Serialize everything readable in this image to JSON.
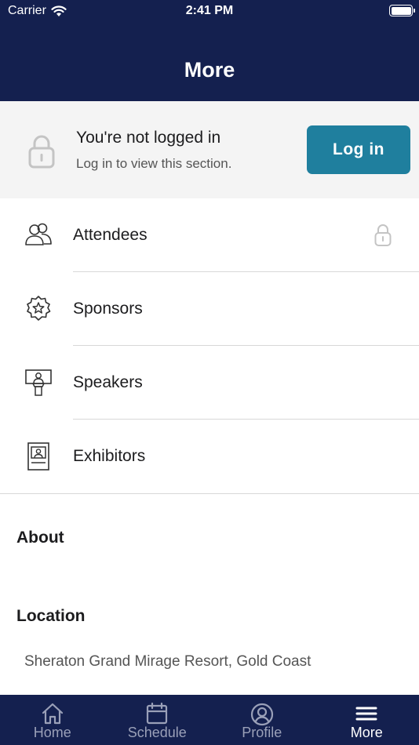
{
  "status_bar": {
    "carrier": "Carrier",
    "time": "2:41 PM"
  },
  "nav": {
    "title": "More"
  },
  "login_banner": {
    "title": "You're not logged in",
    "subtitle": "Log in to view this section.",
    "button_label": "Log in",
    "accent_color": "#1f7f9e"
  },
  "menu": {
    "items": [
      {
        "label": "Attendees",
        "icon": "attendees-icon",
        "locked": true
      },
      {
        "label": "Sponsors",
        "icon": "sponsor-badge-icon",
        "locked": false
      },
      {
        "label": "Speakers",
        "icon": "speaker-podium-icon",
        "locked": false
      },
      {
        "label": "Exhibitors",
        "icon": "exhibitor-booth-icon",
        "locked": false
      }
    ]
  },
  "about": {
    "heading": "About"
  },
  "location": {
    "heading": "Location",
    "value": "Sheraton Grand Mirage Resort, Gold Coast"
  },
  "tab_bar": {
    "background": "#14204f",
    "tabs": [
      {
        "label": "Home",
        "icon": "home-icon",
        "active": false
      },
      {
        "label": "Schedule",
        "icon": "calendar-icon",
        "active": false
      },
      {
        "label": "Profile",
        "icon": "profile-icon",
        "active": false
      },
      {
        "label": "More",
        "icon": "menu-icon",
        "active": true
      }
    ]
  }
}
